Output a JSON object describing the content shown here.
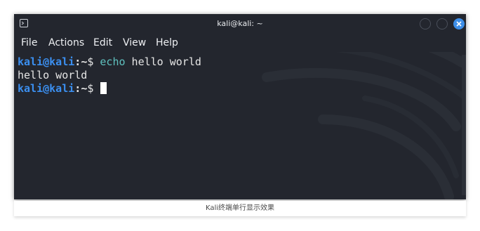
{
  "window": {
    "title": "kali@kali: ~",
    "app_icon": "terminal-icon",
    "controls": [
      "minimize-icon",
      "maximize-icon",
      "close-icon"
    ]
  },
  "menubar": {
    "items": [
      "File",
      "Actions",
      "Edit",
      "View",
      "Help"
    ]
  },
  "terminal": {
    "lines": [
      {
        "user_host": "kali@kali",
        "sep": ":",
        "path": "~",
        "prompt": "$ ",
        "command": "echo",
        "args": " hello world"
      },
      {
        "output": "hello world"
      },
      {
        "user_host": "kali@kali",
        "sep": ":",
        "path": "~",
        "prompt": "$ "
      }
    ]
  },
  "caption": "Kali终端单行显示效果",
  "colors": {
    "background": "#23262e",
    "user_host": "#3b8ff0",
    "command": "#5fc1bf",
    "text": "#e6e6e6",
    "close_button": "#3d8ee8"
  }
}
